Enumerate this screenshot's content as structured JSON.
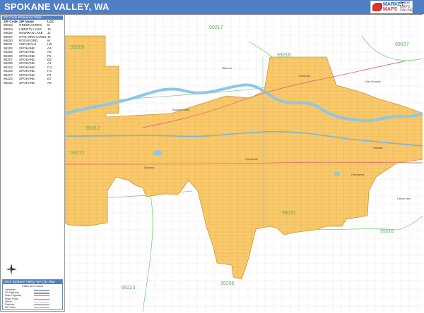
{
  "header": {
    "title": "SPOKANE VALLEY, WA",
    "logo": {
      "line1": "MARKET",
      "line2": "MAPS",
      "side": "SHOP MAPS ONLINE"
    }
  },
  "colors": {
    "title_bar": "#4f7fc4",
    "city_fill": "#f9c96a",
    "city_stroke": "#c9983a",
    "water": "#8ec7e6",
    "zip_boundary": "#7fcf83",
    "zip_label": "#59b25f",
    "highway": "#e0736b",
    "interstate": "#7ab3d9"
  },
  "zip_table": {
    "header": "ZIP Code Reference Table",
    "columns": [
      "ZIP Code",
      "ZIP Name",
      "LOC"
    ],
    "rows": [
      [
        "99016",
        "GREENACRES",
        "I6"
      ],
      [
        "99019",
        "LIBERTY LAKE",
        "J5"
      ],
      [
        "99025",
        "NEWMAN LAKE",
        "J1"
      ],
      [
        "99027",
        "OTIS ORCHARDS",
        "J2"
      ],
      [
        "99030",
        "ROCKFORD",
        "I6"
      ],
      [
        "99037",
        "VERADALE",
        "H6"
      ],
      [
        "99202",
        "SPOKANE",
        "A4"
      ],
      [
        "99203",
        "SPOKANE",
        "A6"
      ],
      [
        "99206",
        "SPOKANE",
        "F5"
      ],
      [
        "99207",
        "SPOKANE",
        "B3"
      ],
      [
        "99208",
        "SPOKANE",
        "A1"
      ],
      [
        "99212",
        "SPOKANE",
        "C4"
      ],
      [
        "99216",
        "SPOKANE",
        "H4"
      ],
      [
        "99217",
        "SPOKANE",
        "F2"
      ],
      [
        "99223",
        "SPOKANE",
        "B7"
      ],
      [
        "99224",
        "SPOKANE",
        "A5"
      ]
    ]
  },
  "map": {
    "zip_labels": [
      "99217",
      "99027",
      "99216",
      "99206",
      "99212",
      "99212",
      "99037",
      "99016",
      "99223",
      "99206"
    ],
    "places": [
      "Millwood",
      "Spokane Valley",
      "Dishman",
      "Opportunity",
      "Greenacres",
      "Liberty Lake",
      "Trentwood",
      "Otis Orchards",
      "Veradale"
    ]
  },
  "legend": {
    "title": "2016 Spokane Valley, WA City Map",
    "subtitle": "Cities and Towns",
    "items": [
      "Interstate",
      "US Highway",
      "State Highway",
      "Major Road",
      "Street",
      "Railroad",
      "ZIP Code"
    ]
  }
}
